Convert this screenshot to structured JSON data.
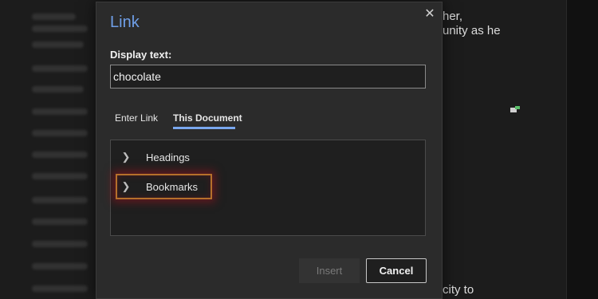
{
  "document": {
    "fragment_1": "her,",
    "fragment_2": "unity as he",
    "fragment_3": "city to"
  },
  "dialog": {
    "title": "Link",
    "close_label": "✕",
    "display_text_label": "Display text:",
    "display_text_value": "chocolate",
    "tabs": [
      {
        "label": "Enter Link",
        "selected": false
      },
      {
        "label": "This Document",
        "selected": true
      }
    ],
    "tree_items": [
      {
        "label": "Headings",
        "icon": "chevron-right-icon"
      },
      {
        "label": "Bookmarks",
        "icon": "chevron-right-icon",
        "highlighted": true
      }
    ],
    "insert_label": "Insert",
    "cancel_label": "Cancel"
  },
  "colors": {
    "accent": "#6f9fe8",
    "tab_underline": "#7aa7ee",
    "highlight_border": "#b5702b"
  }
}
